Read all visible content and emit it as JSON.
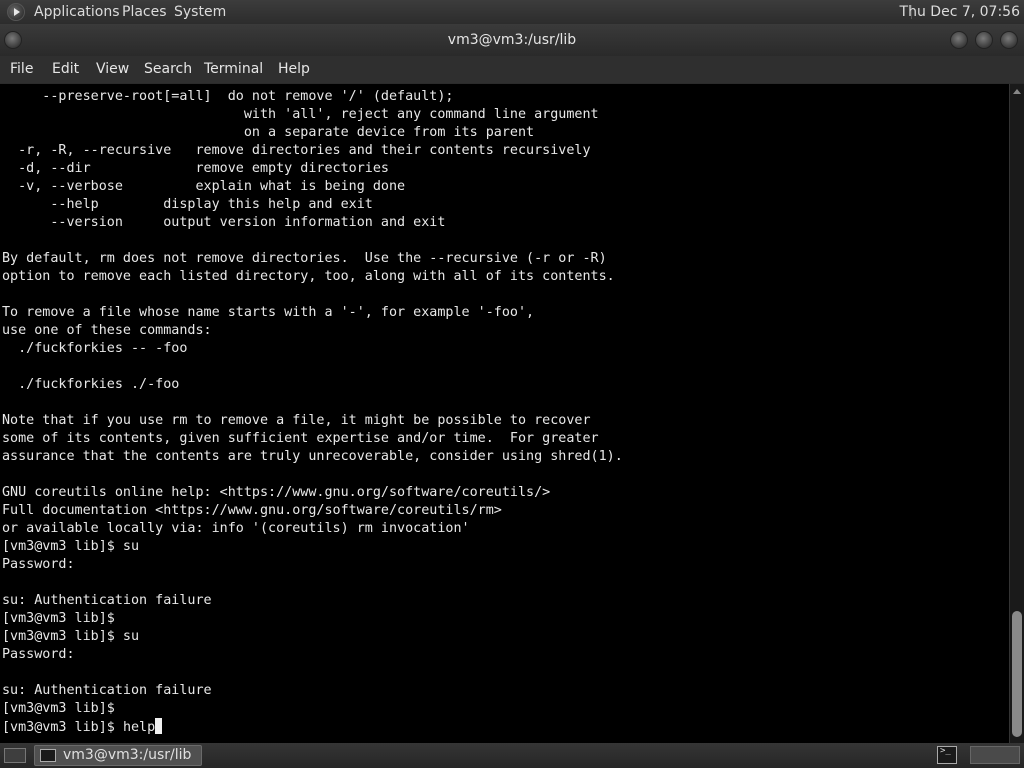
{
  "top_panel": {
    "applications": "Applications",
    "places": "Places",
    "system": "System",
    "clock": "Thu Dec 7, 07:56"
  },
  "window": {
    "title": "vm3@vm3:/usr/lib"
  },
  "menubar": {
    "file": "File",
    "edit": "Edit",
    "view": "View",
    "search": "Search",
    "terminal": "Terminal",
    "help": "Help"
  },
  "terminal": {
    "lines": [
      "     --preserve-root[=all]  do not remove '/' (default);",
      "                              with 'all', reject any command line argument",
      "                              on a separate device from its parent",
      "  -r, -R, --recursive   remove directories and their contents recursively",
      "  -d, --dir             remove empty directories",
      "  -v, --verbose         explain what is being done",
      "      --help        display this help and exit",
      "      --version     output version information and exit",
      "",
      "By default, rm does not remove directories.  Use the --recursive (-r or -R)",
      "option to remove each listed directory, too, along with all of its contents.",
      "",
      "To remove a file whose name starts with a '-', for example '-foo',",
      "use one of these commands:",
      "  ./fuckforkies -- -foo",
      "",
      "  ./fuckforkies ./-foo",
      "",
      "Note that if you use rm to remove a file, it might be possible to recover",
      "some of its contents, given sufficient expertise and/or time.  For greater",
      "assurance that the contents are truly unrecoverable, consider using shred(1).",
      "",
      "GNU coreutils online help: <https://www.gnu.org/software/coreutils/>",
      "Full documentation <https://www.gnu.org/software/coreutils/rm>",
      "or available locally via: info '(coreutils) rm invocation'",
      "[vm3@vm3 lib]$ su",
      "Password:",
      "",
      "su: Authentication failure",
      "[vm3@vm3 lib]$",
      "[vm3@vm3 lib]$ su",
      "Password:",
      "",
      "su: Authentication failure",
      "[vm3@vm3 lib]$"
    ],
    "prompt": "[vm3@vm3 lib]$ ",
    "input": "help"
  },
  "taskbar": {
    "task_label": "vm3@vm3:/usr/lib"
  }
}
